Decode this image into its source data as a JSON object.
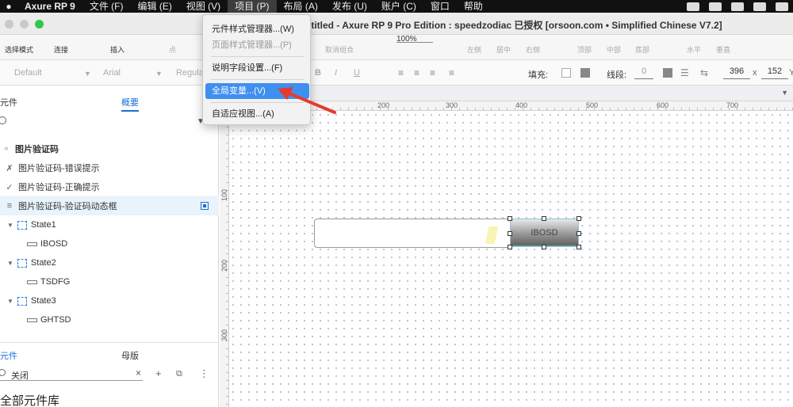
{
  "menubar": {
    "app": "Axure RP 9",
    "items": [
      "文件 (F)",
      "编辑 (E)",
      "视图 (V)",
      "项目 (P)",
      "布局 (A)",
      "发布 (U)",
      "账户 (C)",
      "窗口",
      "帮助"
    ]
  },
  "window": {
    "title": "ntitled - Axure RP 9 Pro Edition : speedzodiac 已授权   [orsoon.com • Simplified Chinese V7.2]"
  },
  "toolbar": {
    "select_mode": "选择模式",
    "connect": "连接",
    "insert": "插入",
    "point": "点",
    "zoom": "100%",
    "ungroup": "取消组合",
    "align_left": "左侧",
    "align_center": "居中",
    "align_right": "右侧",
    "align_top": "顶部",
    "align_middle": "中部",
    "align_bottom": "底部",
    "dist_h": "水平",
    "dist_v": "垂直"
  },
  "formatbar": {
    "style": "Default",
    "font": "Arial",
    "weight": "Regula",
    "bold": "B",
    "italic": "I",
    "underline": "U",
    "fill_label": "填充:",
    "stroke_label": "线段:",
    "stroke_value": "0",
    "x_value": "396",
    "x_label": "x",
    "y_value": "152",
    "y_label": "Y"
  },
  "left_panel": {
    "tab_left": "元件",
    "tab_right": "概要",
    "tree": [
      {
        "label": "图片验证码",
        "type": "page"
      },
      {
        "label": "图片验证码-错误提示",
        "type": "widget"
      },
      {
        "label": "图片验证码-正确提示",
        "type": "widget"
      },
      {
        "label": "图片验证码-验证码动态框",
        "type": "dynamic"
      },
      {
        "label": "State1",
        "type": "state"
      },
      {
        "label": "IBOSD",
        "type": "item"
      },
      {
        "label": "State2",
        "type": "state"
      },
      {
        "label": "TSDFG",
        "type": "item"
      },
      {
        "label": "State3",
        "type": "state"
      },
      {
        "label": "GHTSD",
        "type": "item"
      }
    ],
    "lib_tab_left": "元件",
    "lib_tab_right": "母版",
    "lib_search": "关闭",
    "lib_title": "全部元件库"
  },
  "canvas": {
    "h_ruler": [
      "200",
      "300",
      "400",
      "500",
      "600",
      "700"
    ],
    "v_ruler": [
      "100",
      "200",
      "300"
    ],
    "code_button": "IBOSD"
  },
  "project_menu": {
    "items": [
      {
        "label": "元件样式管理器...(W)",
        "enabled": true
      },
      {
        "label": "页面样式管理器...(P)",
        "enabled": false
      },
      {
        "label": "说明字段设置...(F)",
        "enabled": true
      },
      {
        "label": "全局变量...(V)",
        "enabled": true,
        "highlighted": true
      },
      {
        "label": "自适应视图...(A)",
        "enabled": true
      }
    ]
  },
  "colors": {
    "accent": "#1b6fd8",
    "menu_highlight": "#3f8ff0",
    "annotation_arrow": "#e53b2f"
  }
}
